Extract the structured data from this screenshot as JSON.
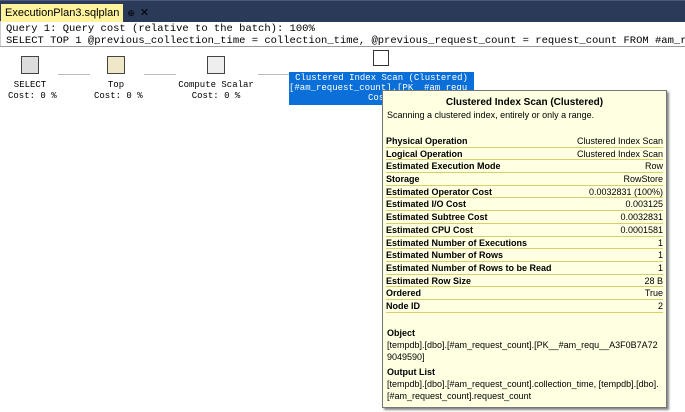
{
  "tab": {
    "title": "ExecutionPlan3.sqlplan",
    "pin": "⊕",
    "close": "✕"
  },
  "query": {
    "line1": "Query 1: Query cost (relative to the batch): 100%",
    "line2": "SELECT TOP 1 @previous_collection_time = collection_time, @previous_request_count = request_count FROM #am_re"
  },
  "nodes": [
    {
      "label": "SELECT",
      "cost": "Cost: 0 %",
      "icon": "select-icon"
    },
    {
      "label": "Top",
      "cost": "Cost: 0 %",
      "icon": "top-icon"
    },
    {
      "label": "Compute Scalar",
      "cost": "Cost: 0 %",
      "icon": "compute-scalar-icon"
    },
    {
      "label": "Clustered Index Scan (Clustered)",
      "sub": "[#am_request_count].[PK__#am_requ__",
      "cost": "Cost:",
      "icon": "clustered-index-scan-icon"
    }
  ],
  "tooltip": {
    "title": "Clustered Index Scan (Clustered)",
    "description": "Scanning a clustered index, entirely or only a range.",
    "rows": [
      [
        "Physical Operation",
        "Clustered Index Scan"
      ],
      [
        "Logical Operation",
        "Clustered Index Scan"
      ],
      [
        "Estimated Execution Mode",
        "Row"
      ],
      [
        "Storage",
        "RowStore"
      ],
      [
        "Estimated Operator Cost",
        "0.0032831 (100%)"
      ],
      [
        "Estimated I/O Cost",
        "0.003125"
      ],
      [
        "Estimated Subtree Cost",
        "0.0032831"
      ],
      [
        "Estimated CPU Cost",
        "0.0001581"
      ],
      [
        "Estimated Number of Executions",
        "1"
      ],
      [
        "Estimated Number of Rows",
        "1"
      ],
      [
        "Estimated Number of Rows to be Read",
        "1"
      ],
      [
        "Estimated Row Size",
        "28 B"
      ],
      [
        "Ordered",
        "True"
      ],
      [
        "Node ID",
        "2"
      ]
    ],
    "object_label": "Object",
    "object_value": "[tempdb].[dbo].[#am_request_count].[PK__#am_requ__A3F0B7A729049590]",
    "output_label": "Output List",
    "output_value": "[tempdb].[dbo].[#am_request_count].collection_time, [tempdb].[dbo].[#am_request_count].request_count"
  },
  "colors": {
    "tab": "#fff29d",
    "selection": "#0a6fd8",
    "tooltip": "#ffffe1"
  }
}
